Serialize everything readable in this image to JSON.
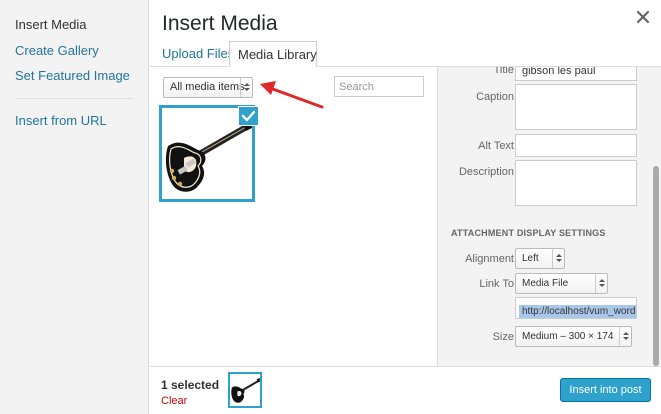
{
  "menu": {
    "items": [
      {
        "label": "Insert Media"
      },
      {
        "label": "Create Gallery"
      },
      {
        "label": "Set Featured Image"
      },
      {
        "label": "Insert from URL"
      }
    ]
  },
  "frame": {
    "title": "Insert Media"
  },
  "tabs": [
    {
      "label": "Upload Files"
    },
    {
      "label": "Media Library"
    }
  ],
  "filter": {
    "selected": "All media items"
  },
  "search": {
    "placeholder": "Search"
  },
  "details": {
    "title_label": "Title",
    "title_value": "gibson les paul",
    "caption_label": "Caption",
    "alt_label": "Alt Text",
    "description_label": "Description"
  },
  "display_settings": {
    "section_title": "ATTACHMENT DISPLAY SETTINGS",
    "alignment_label": "Alignment",
    "alignment_value": "Left",
    "link_label": "Link To",
    "link_value": "Media File",
    "url_value": "http://localhost/vum_wordp",
    "size_label": "Size",
    "size_value": "Medium – 300 × 174"
  },
  "toolbar": {
    "selected_count": "1 selected",
    "clear": "Clear",
    "insert": "Insert into post"
  },
  "colors": {
    "accent": "#2ea2cc",
    "link": "#21759b",
    "danger": "#bc0b0b",
    "annotation_arrow": "#e0282b"
  }
}
